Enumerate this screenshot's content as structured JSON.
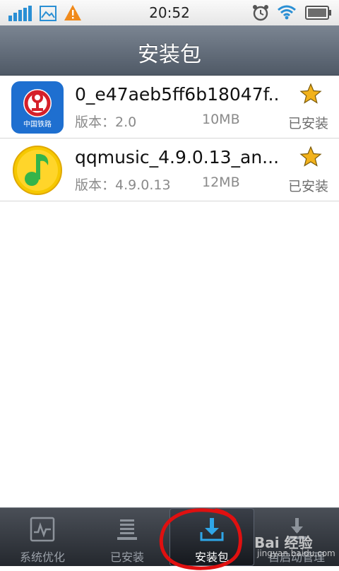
{
  "status_bar": {
    "time": "20:52",
    "left_icons": [
      "signal-bars-icon",
      "image-icon",
      "warning-icon"
    ],
    "right_icons": [
      "alarm-icon",
      "wifi-icon",
      "battery-icon"
    ]
  },
  "header": {
    "title": "安装包"
  },
  "packages": [
    {
      "name": "0_e47aeb5ff6b18047f...",
      "version": "版本：2.0",
      "size": "10MB",
      "status": "已安装",
      "icon": "china-railway-icon",
      "icon_text": "中国铁路"
    },
    {
      "name": "qqmusic_4.9.0.13_an...",
      "version": "版本：4.9.0.13",
      "size": "12MB",
      "status": "已安装",
      "icon": "qq-music-icon"
    }
  ],
  "bottom_nav": {
    "tabs": [
      {
        "label": "系统优化",
        "icon": "monitor-icon"
      },
      {
        "label": "已安装",
        "icon": "list-icon"
      },
      {
        "label": "安装包",
        "icon": "download-icon",
        "active": true
      },
      {
        "label": "自启动管理",
        "icon": "startup-icon"
      }
    ]
  },
  "watermark": {
    "text": "Bai 经验",
    "sub": "jingyan.baidu.com"
  },
  "colors": {
    "header": "#5f6976",
    "star": "#f2b21b",
    "railway": "#1e6fd0",
    "qq_music": "#f6c800",
    "annotation": "#e01010",
    "nav_bg": "#2e3238"
  }
}
